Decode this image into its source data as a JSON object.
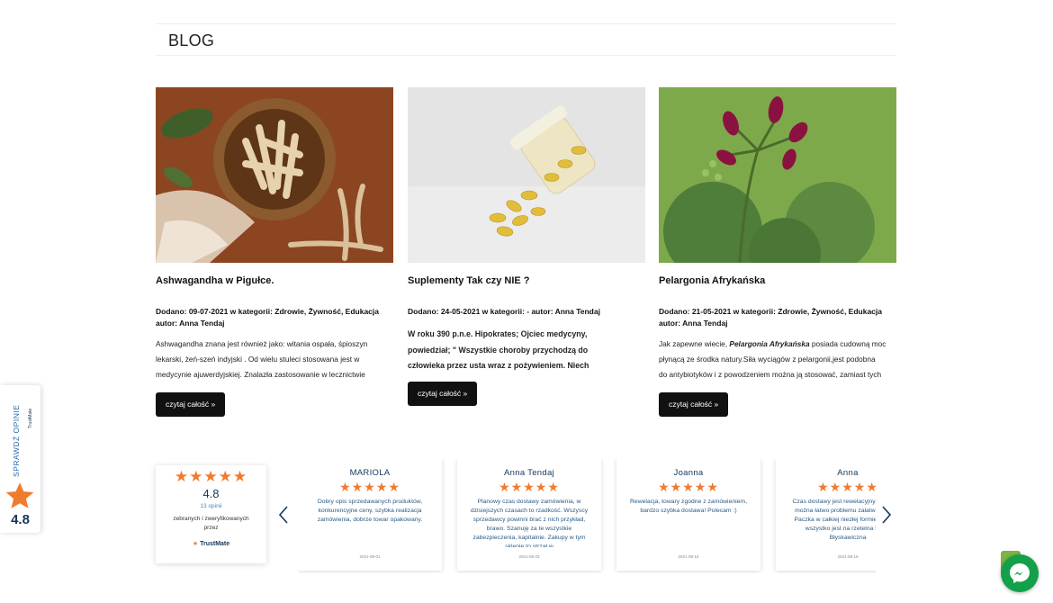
{
  "blog": {
    "heading": "BLOG"
  },
  "posts": [
    {
      "title": "Ashwagandha w Pigułce.",
      "meta_line1": "Dodano: 09-07-2021 w kategorii: Zdrowie, Żywność, Edukacja",
      "meta_line2": "autor: Anna Tendaj",
      "excerpt": [
        " Ashwagandha znana jest również jako: witania ospała, śpioszyn",
        "lekarski, żeń-szeń indyjski . Od wielu stuleci stosowana jest w",
        "medycynie ajuwerdyjskiej. Znalazła zastosowanie w lecznictwie"
      ],
      "button": "czytaj całość »"
    },
    {
      "title": "Suplementy Tak czy NIE ?",
      "meta_line1": "Dodano: 24-05-2021 w kategorii: - autor: Anna Tendaj",
      "excerpt": [
        "W roku 390 p.n.e. Hipokrates; Ojciec medycyny,",
        "powiedział; \" Wszystkie choroby przychodzą do",
        "człowieka przez usta wraz z pożywieniem. Niech"
      ],
      "button": "czytaj całość »"
    },
    {
      "title": "Pelargonia Afrykańska",
      "meta_line1": "Dodano: 21-05-2021 w kategorii: Zdrowie, Żywność, Edukacja",
      "meta_line2": "autor: Anna Tendaj",
      "excerpt_prefix": "Jak zapewne wiecie, ",
      "excerpt_em": "Pelargonia Afrykańska",
      "excerpt_suffix": " posiada cudowną moc",
      "excerpt": [
        "płynącą ze środka natury.Siła wyciągów z pelargonii,jest podobna",
        "do antybiotyków i z powodzeniem można ją stosować, zamiast tych"
      ],
      "button": "czytaj całość »"
    }
  ],
  "trustmate_tab": {
    "label": "SPRAWDŹ OPINIE",
    "brand": "TrustMate",
    "score": "4.8"
  },
  "summary": {
    "stars": "★★★★★",
    "rating": "4.8",
    "count": "13 opinii",
    "note": "zebranych i zweryfikowanych przez",
    "brand_star": "★",
    "brand": "TrustMate"
  },
  "reviews": [
    {
      "name": "MARIOLA",
      "stars": "★★★★★",
      "text": "Dobry opis sprzedawanych produktów, konkurencyjne ceny, szybka realizacja zamówienia, dobrze towar opakowany.",
      "date": "2021-08-01"
    },
    {
      "name": "Anna Tendaj",
      "stars": "★★★★★",
      "text": "Planowy czas dostawy zamówienia, w dzisiejszych czasach to rzadkość. Wszyscy sprzedawcy powinni brać z nich przykład, brawo. Szanuję za te wszystkie zabezpieczenia, kapitalnie. Zakupy w tym sklepie to strzał w",
      "date": "2021-08-23"
    },
    {
      "name": "Joanna",
      "stars": "★★★★★",
      "text": "Rewelacja, towary zgodne z zamówieniem, bardzo szybka dostawa! Polecam :)",
      "date": "2021-08-15"
    },
    {
      "name": "Anna",
      "stars": "★★★★★",
      "text": "Czas dostawy jest rewelacyjny, wszystko można łatwo problemu załatwić. Super. Paczka w całkiej niezłej formie. Zawsze wszystko jest na rzetelna firma. Błyskawiczna",
      "date": "2021-08-16"
    }
  ],
  "colors": {
    "accent_orange": "#f07a2e",
    "navy": "#13375b",
    "button_bg": "#111111",
    "messenger_green": "#12a14a"
  }
}
